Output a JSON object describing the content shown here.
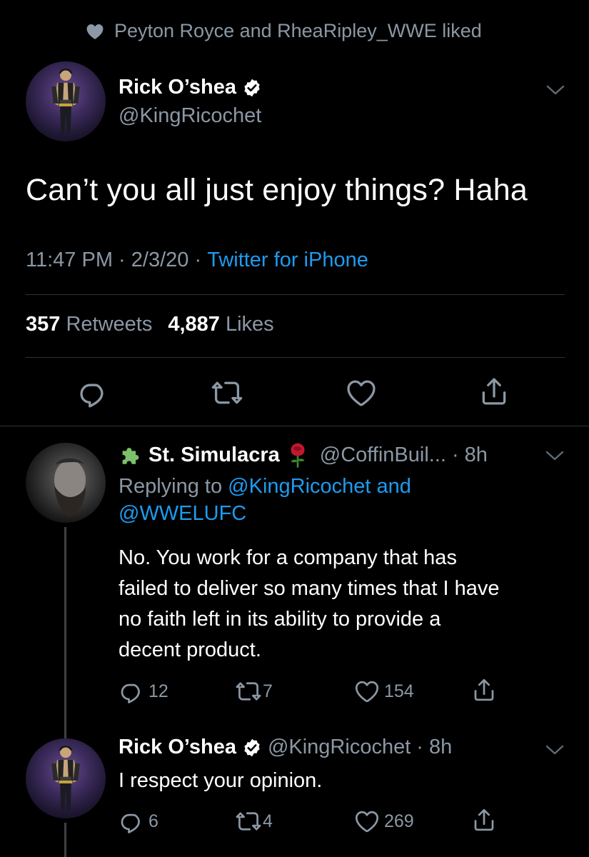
{
  "social_context": {
    "text": "Peyton Royce and RheaRipley_WWE liked"
  },
  "main_tweet": {
    "name": "Rick O’shea",
    "handle": "@KingRicochet",
    "text": "Can’t you all just enjoy things? Haha",
    "time": "11:47 PM",
    "date": "2/3/20",
    "source": "Twitter for iPhone",
    "retweets_count": "357",
    "retweets_label": "Retweets",
    "likes_count": "4,887",
    "likes_label": "Likes"
  },
  "reply1": {
    "name": "St. Simulacra",
    "handle": "@CoffinBuil...",
    "age": "8h",
    "replying_prefix": "Replying to",
    "replying_user1": "@KingRicochet",
    "replying_and": "and",
    "replying_user2": "@WWELUFC",
    "text_lines": [
      "No. You work for a company that has",
      "failed to deliver so many times that I have",
      "no faith left in its ability to provide a",
      "decent product."
    ],
    "replies": "12",
    "retweets": "7",
    "likes": "154"
  },
  "reply2": {
    "name": "Rick O’shea",
    "handle": "@KingRicochet",
    "age": "8h",
    "text": "I respect your opinion.",
    "replies": "6",
    "retweets": "4",
    "likes": "269"
  },
  "separators": {
    "dot": "·",
    "dot_spaced": " · "
  },
  "icons": [
    "heart-icon",
    "verified-badge-icon",
    "chevron-down-icon",
    "reply-icon",
    "retweet-icon",
    "like-icon",
    "share-icon",
    "puzzle-icon",
    "rose-icon"
  ],
  "colors": {
    "background": "#000000",
    "muted": "#8b98a5",
    "link": "#1d9bf0",
    "divider": "#2f3336"
  }
}
